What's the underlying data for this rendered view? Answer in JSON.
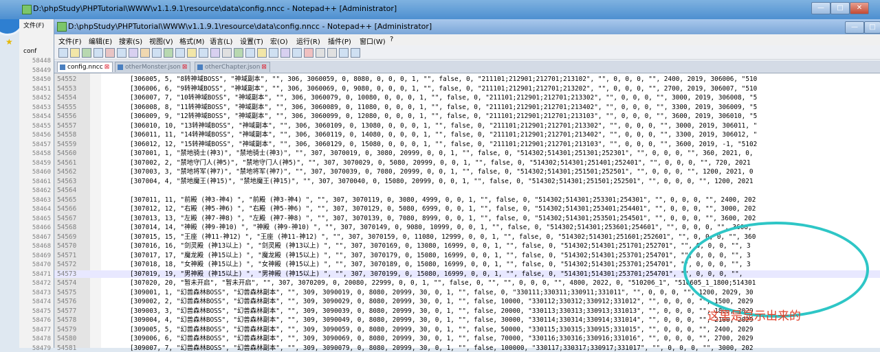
{
  "back_window": {
    "title": "D:\\phpStudy\\PHPTutorial\\WWW\\v1.1.9.1\\resource\\data\\config.nncc - Notepad++ [Administrator]",
    "menu_file": "文件(F)",
    "tab_label": "conf",
    "line_numbers": [
      "58448",
      "58449",
      "58450",
      "58451",
      "58452",
      "58453",
      "58454",
      "58455",
      "58456",
      "58457",
      "58458",
      "58459",
      "58460",
      "58461",
      "58462",
      "58463",
      "58464",
      "58465",
      "58466",
      "58467",
      "58468",
      "58469",
      "58470",
      "58471",
      "58472",
      "58473",
      "58474",
      "58475",
      "58476",
      "58477",
      "58478",
      "58479"
    ]
  },
  "window": {
    "title": "D:\\phpStudy\\PHPTutorial\\WWW\\v1.1.9.1\\resource\\data\\config.nncc - Notepad++ [Administrator]",
    "controls": {
      "minimize": "—",
      "maximize": "□",
      "close": "✕"
    }
  },
  "menu": [
    "文件(F)",
    "编辑(E)",
    "搜索(S)",
    "视图(V)",
    "格式(M)",
    "语言(L)",
    "设置(T)",
    "宏(O)",
    "运行(R)",
    "插件(P)",
    "窗口(W)",
    "?"
  ],
  "tabs": [
    {
      "label": "config.nncc",
      "active": true
    },
    {
      "label": "otherMonster.json",
      "active": false
    },
    {
      "label": "otherChapter.json",
      "active": false
    }
  ],
  "editor": {
    "highlighted_line": "54573",
    "lines": [
      {
        "n": "54552",
        "t": "[306005, 5, \"8转神域BOSS\", \"神域副本\", \"\", 306, 3060059, 0, 8080, 0, 0, 0, 1, \"\", false, 0, \"211101;212901;212701;213102\", \"\", 0, 0, 0, \"\", 2400, 2019, 306006, \"510"
      },
      {
        "n": "54553",
        "t": "[306006, 6, \"9转神域BOSS\", \"神域副本\", \"\", 306, 3060069, 0, 9080, 0, 0, 0, 1, \"\", false, 0, \"211101;212901;212701;213202\", \"\", 0, 0, 0, \"\", 2700, 2019, 306007, \"510"
      },
      {
        "n": "54554",
        "t": "[306007, 7, \"10转神域BOSS\", \"神域副本\", \"\", 306, 3060079, 0, 10080, 0, 0, 0, 1, \"\", false, 0, \"211101;212901;212701;213302\", \"\", 0, 0, 0, \"\", 3000, 2019, 306008, \"5"
      },
      {
        "n": "54555",
        "t": "[306008, 8, \"11转神域BOSS\", \"神域副本\", \"\", 306, 3060089, 0, 11080, 0, 0, 0, 1, \"\", false, 0, \"211101;212901;212701;213402\", \"\", 0, 0, 0, \"\", 3300, 2019, 306009, \"5"
      },
      {
        "n": "54556",
        "t": "[306009, 9, \"12转神域BOSS\", \"神域副本\", \"\", 306, 3060099, 0, 12080, 0, 0, 0, 1, \"\", false, 0, \"211101;212901;212701;213103\", \"\", 0, 0, 0, \"\", 3600, 2019, 306010, \"5"
      },
      {
        "n": "54557",
        "t": "[306010, 10, \"13转神域BOSS\", \"神域副本\", \"\", 306, 3060109, 0, 13080, 0, 0, 0, 1, \"\", false, 0, \"211101;212901;212701;213302\", \"\", 0, 0, 0, \"\", 3000, 2019, 306011, \""
      },
      {
        "n": "54558",
        "t": "[306011, 11, \"14转神域BOSS\", \"神域副本\", \"\", 306, 3060119, 0, 14080, 0, 0, 0, 1, \"\", false, 0, \"211101;212901;212701;213402\", \"\", 0, 0, 0, \"\", 3300, 2019, 306012, \""
      },
      {
        "n": "54559",
        "t": "[306012, 12, \"15转神域BOSS\", \"神域副本\", \"\", 306, 3060129, 0, 15080, 0, 0, 0, 1, \"\", false, 0, \"211101;212901;212701;213103\", \"\", 0, 0, 0, \"\", 3600, 2019, -1, \"5102"
      },
      {
        "n": "54560",
        "t": "[307001, 1, \"禁地骑士(神3)\", \"禁地骑士(神3)\", \"\", 307, 3070019, 0, 3080, 20999, 0, 0, 1, \"\", false, 0, \"514302;514301;251301;252301\", \"\", 0, 0, 0, \"\", 360, 2021, 0,"
      },
      {
        "n": "54561",
        "t": "[307002, 2, \"禁地守门人(神5)\", \"禁地守门人(神5)\", \"\", 307, 3070029, 0, 5080, 20999, 0, 0, 1, \"\", false, 0, \"514302;514301;251401;252401\", \"\", 0, 0, 0, \"\", 720, 2021"
      },
      {
        "n": "54562",
        "t": "[307003, 3, \"禁地将军(神7)\", \"禁地将军(神7)\", \"\", 307, 3070039, 0, 7080, 20999, 0, 0, 1, \"\", false, 0, \"514302;514301;251501;252501\", \"\", 0, 0, 0, \"\", 1200, 2021, 0"
      },
      {
        "n": "54563",
        "t": "[307004, 4, \"禁地魔王(神15)\", \"禁地魔王(神15)\", \"\", 307, 3070040, 0, 15080, 20999, 0, 0, 1, \"\", false, 0, \"514302;514301;251501;252501\", \"\", 0, 0, 0, \"\", 1200, 2021"
      },
      {
        "n": "54564",
        "t": ""
      },
      {
        "n": "54565",
        "t": "[307011, 11, \"前殿 (神3-神4) \", \"前殿 (神3-神4) \", \"\", 307, 3070119, 0, 3080, 4999, 0, 0, 1, \"\", false, 0, \"514302;514301;253301;254301\", \"\", 0, 0, 0, \"\", 2400, 202"
      },
      {
        "n": "54566",
        "t": "[307012, 12, \"右殿 (神5-神6) \", \"右殿 (神5-神6) \", \"\", 307, 3070129, 0, 5080, 6999, 0, 0, 1, \"\", false, 0, \"514302;514301;253401;254401\", \"\", 0, 0, 0, \"\", 3000, 202"
      },
      {
        "n": "54567",
        "t": "[307013, 13, \"左殿 (神7-神8) \", \"左殿 (神7-神8) \", \"\", 307, 3070139, 0, 7080, 8999, 0, 0, 1, \"\", false, 0, \"514302;514301;253501;254501\", \"\", 0, 0, 0, \"\", 3600, 202"
      },
      {
        "n": "54568",
        "t": "[307014, 14, \"神殿 (神9-神10) \", \"神殿 (神9-神10) \", \"\", 307, 3070149, 0, 9080, 10999, 0, 0, 1, \"\", false, 0, \"514302;514301;253601;254601\", \"\", 0, 0, 0, \"\", 3600,"
      },
      {
        "n": "54569",
        "t": "[307015, 15, \"王座 (神11-神12) \", \"王座 (神11-神12) \", \"\", 307, 3070159, 0, 11080, 12999, 0, 0, 1, \"\", false, 0, \"514302;514301;251601;252601\", \"\", 0, 0, 0, \"\", 360"
      },
      {
        "n": "54570",
        "t": "[307016, 16, \"剑灵殿 (神13以上) \", \"剑灵殿 (神13以上) \", \"\", 307, 3070169, 0, 13080, 16999, 0, 0, 1, \"\", false, 0, \"514302;514301;251701;252701\", \"\", 0, 0, 0, \"\", 3"
      },
      {
        "n": "54571",
        "t": "[307017, 17, \"魔龙殿 (神15以上) \", \"魔龙殿 (神15以上) \", \"\", 307, 3070179, 0, 15080, 16999, 0, 0, 1, \"\", false, 0, \"514302;514301;253701;254701\", \"\", 0, 0, 0, \"\", 3"
      },
      {
        "n": "54572",
        "t": "[307018, 18, \"女神殿 (神15以上) \", \"女神殿 (神15以上) \", \"\", 307, 3070189, 0, 15080, 16999, 0, 0, 1, \"\", false, 0, \"514302;514301;253701;254701\", \"\", 0, 0, 0, \"\", 3"
      },
      {
        "n": "54573",
        "t": "[307019, 19, \"男神殿 (神15以上) \", \"男神殿 (神15以上) \", \"\", 307, 3070199, 0, 15080, 16999, 0, 0, 1, \"\", false, 0, \"514301;514301;253701;254701\", \"\", 0, 0, 0, \"\","
      },
      {
        "n": "54574",
        "t": "[307020, 20, \"暂未开启\", \"暂未开启\", \"\", 307, 3070209, 0, 20080, 22999, 0, 0, 1, \"\", false, 0, \"\", \"\", 0, 0, 0, \"\", 4800, 2022, 0, \"510206_1\", \"510605_1_1800;514301"
      },
      {
        "n": "54575",
        "t": "[309001, 1, \"幻兽森林BOSS\", \"幻兽森林副本\", \"\", 309, 3090019, 0, 8080, 20999, 30, 0, 1, \"\", false, 0, \"330111;330311;330911;331011\", \"\", 0, 0, 0, \"\", 1200, 2029, 30"
      },
      {
        "n": "54576",
        "t": "[309002, 2, \"幻兽森林BOSS\", \"幻兽森林副本\", \"\", 309, 3090029, 0, 8080, 20999, 30, 0, 1, \"\", false, 10000, \"330112;330312;330912;331012\", \"\", 0, 0, 0, \"\", 1500, 2029"
      },
      {
        "n": "54577",
        "t": "[309003, 3, \"幻兽森林BOSS\", \"幻兽森林副本\", \"\", 309, 3090039, 0, 8080, 20999, 30, 0, 1, \"\", false, 20000, \"330113;330313;330913;331013\", \"\", 0, 0, 0, \"\", 1800, 2029"
      },
      {
        "n": "54578",
        "t": "[309004, 4, \"幻兽森林BOSS\", \"幻兽森林副本\", \"\", 309, 3090049, 0, 8080, 20999, 30, 0, 1, \"\", false, 30000, \"330114;330314;330914;331014\", \"\", 0, 0, 0, \"\", 2100, 2029"
      },
      {
        "n": "54579",
        "t": "[309005, 5, \"幻兽森林BOSS\", \"幻兽森林副本\", \"\", 309, 3090059, 0, 8080, 20999, 30, 0, 1, \"\", false, 50000, \"330115;330315;330915;331015\", \"\", 0, 0, 0, \"\", 2400, 2029"
      },
      {
        "n": "54580",
        "t": "[309006, 6, \"幻兽森林BOSS\", \"幻兽森林副本\", \"\", 309, 3090069, 0, 8080, 20999, 30, 0, 1, \"\", false, 70000, \"330116;330316;330916;331016\", \"\", 0, 0, 0, \"\", 2700, 2029"
      },
      {
        "n": "54581",
        "t": "[309007, 7, \"幻兽森林BOSS\", \"幻兽森林副本\", \"\", 309, 3090079, 0, 8080, 20999, 30, 0, 1, \"\", false, 100000, \"330117;330317;330917;331017\", \"\", 0, 0, 0, \"\", 3000, 202"
      }
    ]
  },
  "annotation": {
    "text": "这里是显示出来的",
    "ring_color": "#2ec6c6",
    "text_color": "#e0402a"
  }
}
